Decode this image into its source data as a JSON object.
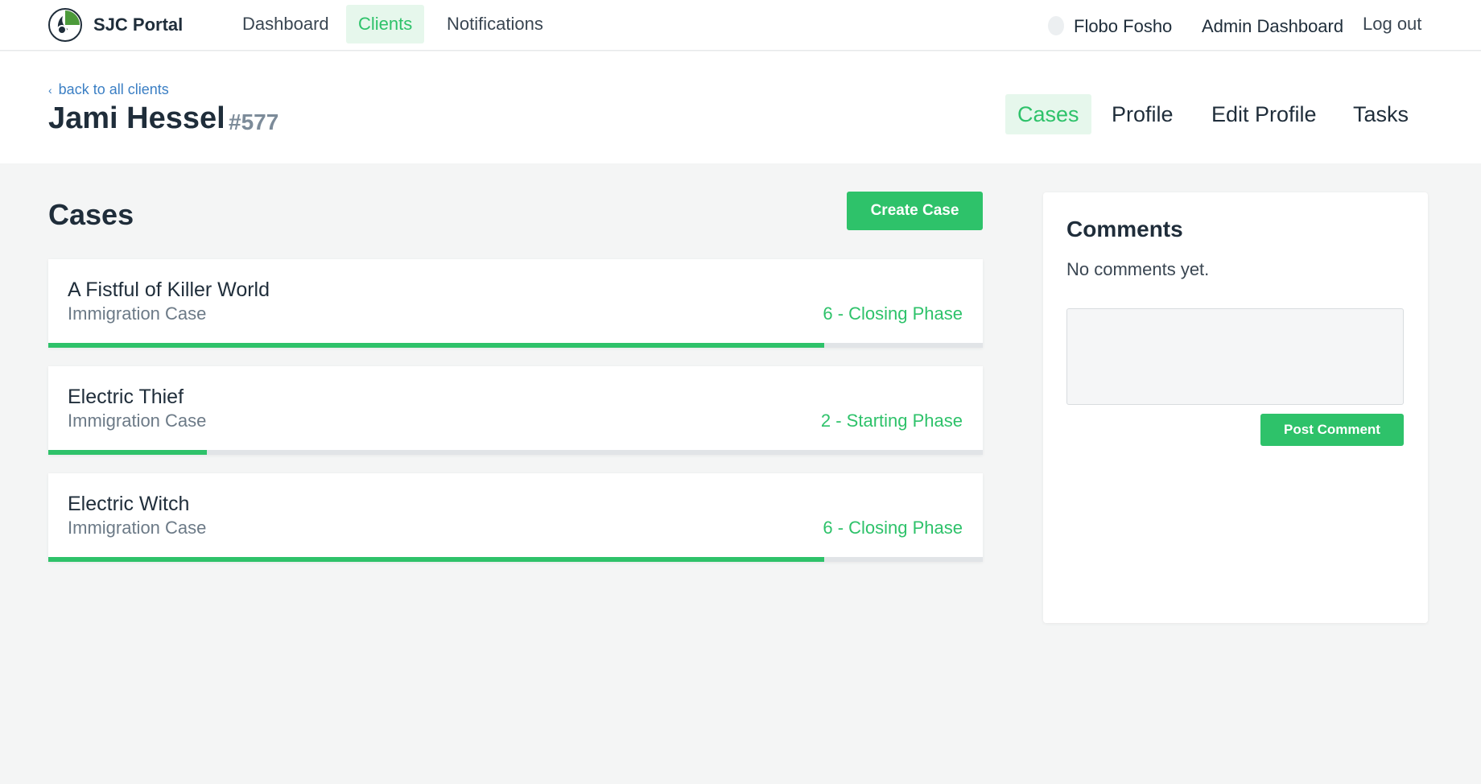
{
  "nav": {
    "brand": "SJC Portal",
    "links": [
      {
        "label": "Dashboard",
        "active": false
      },
      {
        "label": "Clients",
        "active": true
      },
      {
        "label": "Notifications",
        "active": false
      }
    ],
    "user_name": "Flobo Fosho",
    "admin_label": "Admin Dashboard",
    "logout_label": "Log out",
    "icons": {
      "logo": "sjc-portal-logo",
      "avatar": "user-avatar"
    }
  },
  "header": {
    "back_label": "back to all clients",
    "back_icon": "chevron-left-icon",
    "client_name": "Jami Hessel",
    "client_id": "#577",
    "tabs": [
      {
        "label": "Cases",
        "active": true
      },
      {
        "label": "Profile",
        "active": false
      },
      {
        "label": "Edit Profile",
        "active": false
      },
      {
        "label": "Tasks",
        "active": false
      }
    ]
  },
  "cases": {
    "title": "Cases",
    "create_label": "Create Case",
    "items": [
      {
        "title": "A Fistful of Killer World",
        "type": "Immigration Case",
        "phase": "6 - Closing Phase",
        "progress_pct": 83
      },
      {
        "title": "Electric Thief",
        "type": "Immigration Case",
        "phase": "2 - Starting Phase",
        "progress_pct": 17
      },
      {
        "title": "Electric Witch",
        "type": "Immigration Case",
        "phase": "6 - Closing Phase",
        "progress_pct": 83
      }
    ]
  },
  "comments": {
    "title": "Comments",
    "empty_text": "No comments yet.",
    "input_value": "",
    "post_label": "Post Comment"
  },
  "colors": {
    "accent": "#2ec26a",
    "accent_bg": "#e6f7ec",
    "link": "#3b7fc4",
    "page_bg": "#f4f5f5"
  }
}
